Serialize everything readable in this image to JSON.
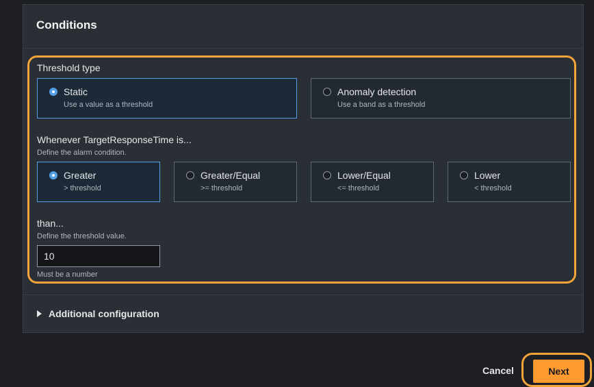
{
  "panel": {
    "title": "Conditions"
  },
  "threshold_type": {
    "label": "Threshold type",
    "options": [
      {
        "title": "Static",
        "desc": "Use a value as a threshold",
        "selected": true
      },
      {
        "title": "Anomaly detection",
        "desc": "Use a band as a threshold",
        "selected": false
      }
    ]
  },
  "condition": {
    "label": "Whenever TargetResponseTime is...",
    "desc": "Define the alarm condition.",
    "options": [
      {
        "title": "Greater",
        "desc": "> threshold",
        "selected": true
      },
      {
        "title": "Greater/Equal",
        "desc": ">= threshold",
        "selected": false
      },
      {
        "title": "Lower/Equal",
        "desc": "<= threshold",
        "selected": false
      },
      {
        "title": "Lower",
        "desc": "< threshold",
        "selected": false
      }
    ]
  },
  "threshold": {
    "label": "than...",
    "desc": "Define the threshold value.",
    "value": "10",
    "hint": "Must be a number"
  },
  "additional": {
    "label": "Additional configuration"
  },
  "footer": {
    "cancel_label": "Cancel",
    "next_label": "Next"
  },
  "colors": {
    "accent": "#ff9a2e",
    "highlight": "#f2a33a",
    "selected": "#539fe5"
  }
}
